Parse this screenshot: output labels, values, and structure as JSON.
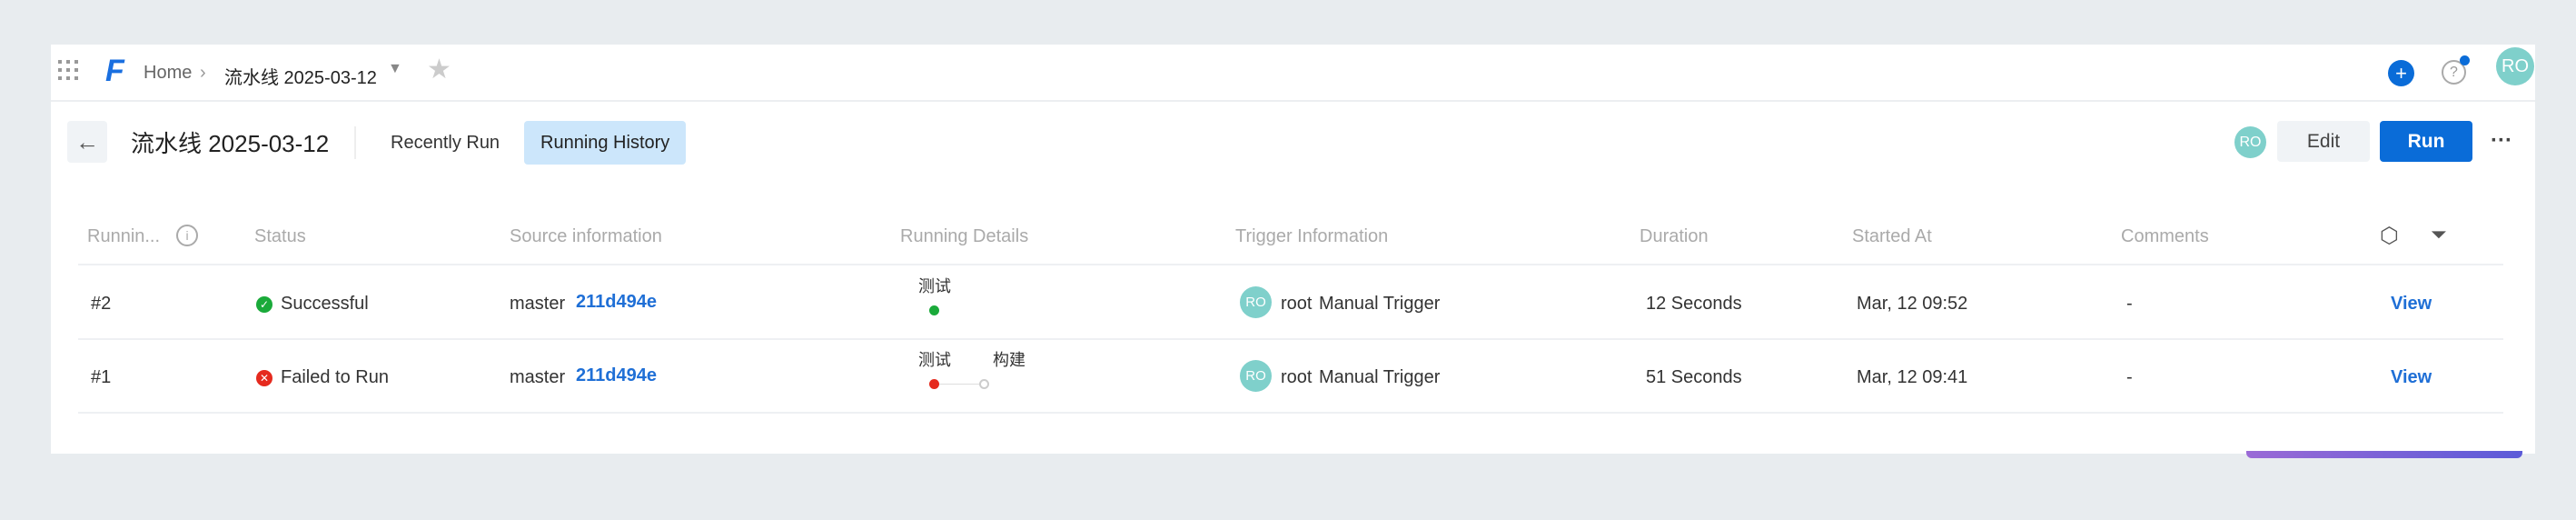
{
  "topbar": {
    "home": "Home",
    "pipeline": "流水线 2025-03-12",
    "user_initials": "RO"
  },
  "header": {
    "title": "流水线 2025-03-12",
    "tabs": [
      "Recently Run",
      "Running History"
    ],
    "owner_initials": "RO",
    "edit": "Edit",
    "run": "Run"
  },
  "table": {
    "columns": [
      "Runnin...",
      "Status",
      "Source information",
      "Running Details",
      "Trigger Information",
      "Duration",
      "Started At",
      "Comments"
    ],
    "rows": [
      {
        "id": "#2",
        "status": "Successful",
        "branch": "master",
        "commit": "211d494e",
        "stages": [
          "测试"
        ],
        "trigger_initials": "RO",
        "trigger_user": "root",
        "trigger_type": "Manual Trigger",
        "duration": "12 Seconds",
        "started": "Mar, 12 09:52",
        "comments": "-",
        "action": "View"
      },
      {
        "id": "#1",
        "status": "Failed to Run",
        "branch": "master",
        "commit": "211d494e",
        "stages": [
          "测试",
          "构建"
        ],
        "trigger_initials": "RO",
        "trigger_user": "root",
        "trigger_type": "Manual Trigger",
        "duration": "51 Seconds",
        "started": "Mar, 12 09:41",
        "comments": "-",
        "action": "View"
      }
    ]
  },
  "colors": {
    "accent": "#0a6cd8",
    "success": "#1aaa3a",
    "error": "#e52a1e",
    "avatar": "#7fd0cb",
    "tab_active": "#cce6fb"
  }
}
